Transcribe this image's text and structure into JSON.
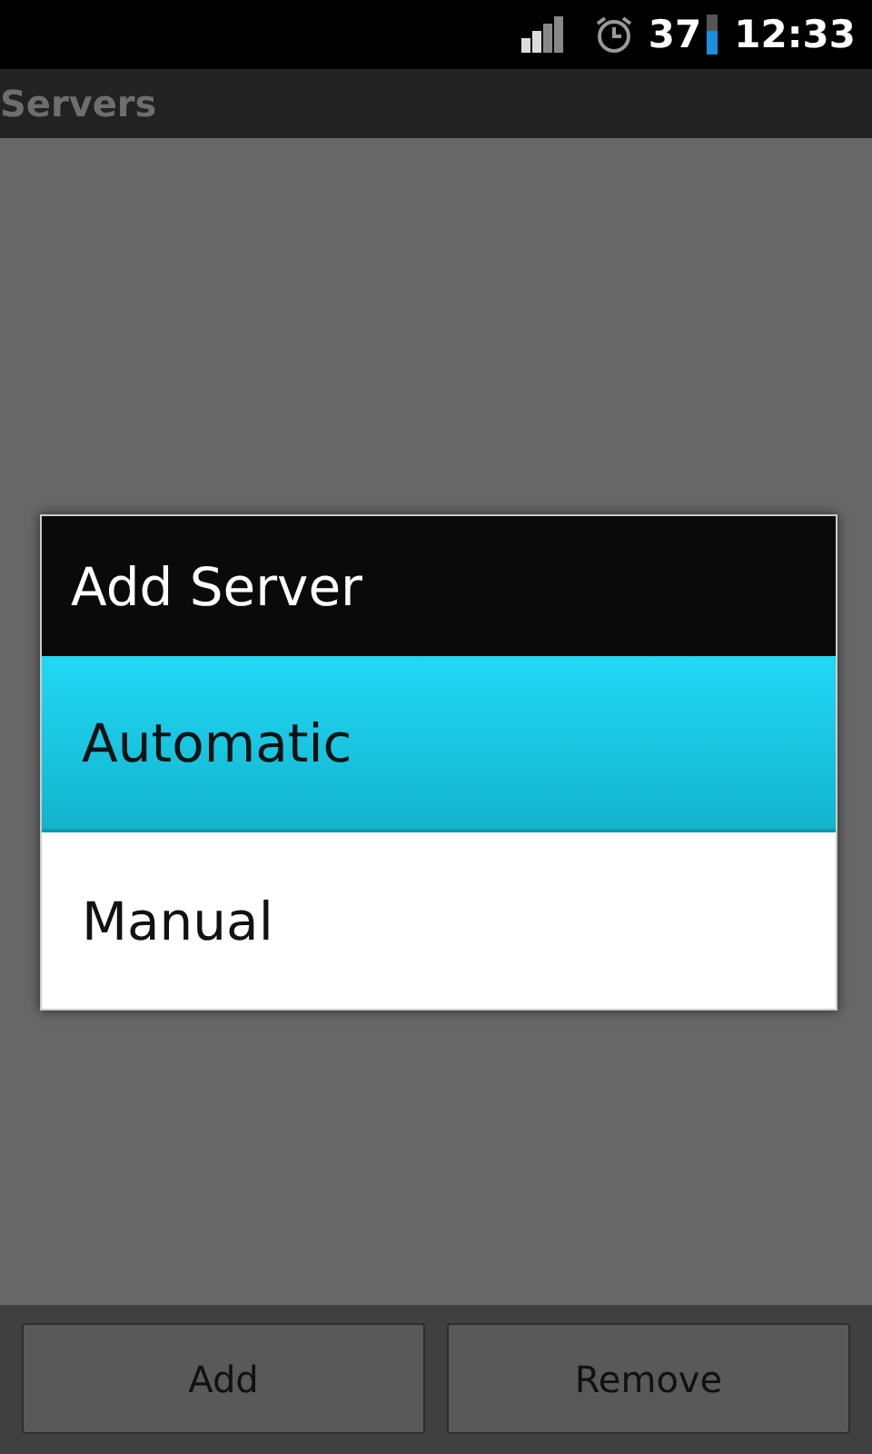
{
  "status_bar": {
    "battery": "37",
    "time": "12:33"
  },
  "title_bar": {
    "title": "Servers"
  },
  "dialog": {
    "title": "Add Server",
    "items": [
      {
        "label": "Automatic",
        "selected": true
      },
      {
        "label": "Manual",
        "selected": false
      }
    ]
  },
  "buttons": [
    "Add",
    "Remove"
  ]
}
